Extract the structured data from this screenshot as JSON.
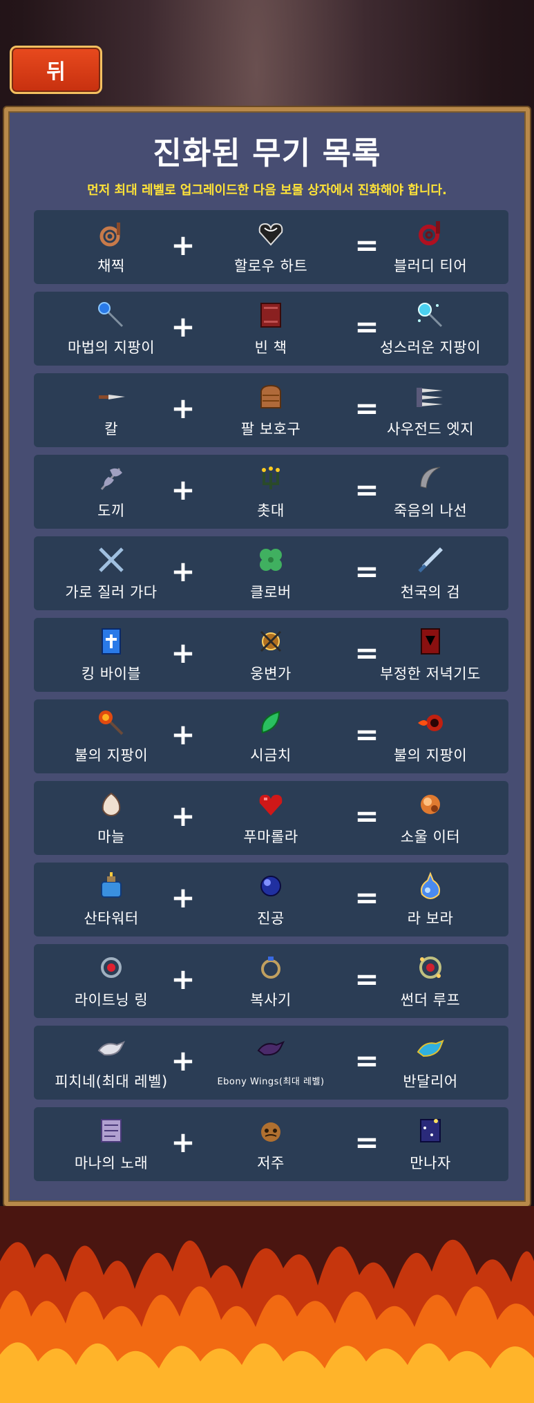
{
  "back_button": {
    "label": "뒤"
  },
  "panel": {
    "title": "진화된 무기 목록",
    "subtitle": "먼저 최대 레벨로 업그레이드한 다음 보물 상자에서 진화해야 합니다."
  },
  "plus_symbol": "+",
  "equals_symbol": "=",
  "recipes": [
    {
      "a": {
        "label": "채찍",
        "icon": "whip-icon"
      },
      "b": {
        "label": "할로우 하트",
        "icon": "hollow-heart-icon"
      },
      "r": {
        "label": "블러디 티어",
        "icon": "bloody-tear-icon"
      }
    },
    {
      "a": {
        "label": "마법의 지팡이",
        "icon": "magic-wand-icon"
      },
      "b": {
        "label": "빈 책",
        "icon": "empty-tome-icon"
      },
      "r": {
        "label": "성스러운 지팡이",
        "icon": "holy-wand-icon"
      }
    },
    {
      "a": {
        "label": "칼",
        "icon": "knife-icon"
      },
      "b": {
        "label": "팔 보호구",
        "icon": "bracer-icon"
      },
      "r": {
        "label": "사우전드 엣지",
        "icon": "thousand-edge-icon"
      }
    },
    {
      "a": {
        "label": "도끼",
        "icon": "axe-icon"
      },
      "b": {
        "label": "촛대",
        "icon": "candelabrador-icon"
      },
      "r": {
        "label": "죽음의 나선",
        "icon": "death-spiral-icon"
      }
    },
    {
      "a": {
        "label": "가로 질러 가다",
        "icon": "cross-icon"
      },
      "b": {
        "label": "클로버",
        "icon": "clover-icon"
      },
      "r": {
        "label": "천국의 검",
        "icon": "heaven-sword-icon"
      }
    },
    {
      "a": {
        "label": "킹 바이블",
        "icon": "king-bible-icon"
      },
      "b": {
        "label": "웅변가",
        "icon": "spellbinder-icon"
      },
      "r": {
        "label": "부정한 저녁기도",
        "icon": "unholy-vespers-icon"
      }
    },
    {
      "a": {
        "label": "불의 지팡이",
        "icon": "fire-wand-icon"
      },
      "b": {
        "label": "시금치",
        "icon": "spinach-icon"
      },
      "r": {
        "label": "불의 지팡이",
        "icon": "hellfire-icon"
      }
    },
    {
      "a": {
        "label": "마늘",
        "icon": "garlic-icon"
      },
      "b": {
        "label": "푸마롤라",
        "icon": "pummarola-icon"
      },
      "r": {
        "label": "소울 이터",
        "icon": "soul-eater-icon"
      }
    },
    {
      "a": {
        "label": "산타워터",
        "icon": "santa-water-icon"
      },
      "b": {
        "label": "진공",
        "icon": "attractorb-icon"
      },
      "r": {
        "label": "라 보라",
        "icon": "la-borra-icon"
      }
    },
    {
      "a": {
        "label": "라이트닝 링",
        "icon": "lightning-ring-icon"
      },
      "b": {
        "label": "복사기",
        "icon": "duplicator-icon"
      },
      "r": {
        "label": "썬더 루프",
        "icon": "thunder-loop-icon"
      }
    },
    {
      "a": {
        "label": "피치네(최대 레벨)",
        "icon": "peachone-icon"
      },
      "b": {
        "label": "Ebony Wings(최대 레벨)",
        "icon": "ebony-wings-icon",
        "small": true
      },
      "r": {
        "label": "반달리어",
        "icon": "vandalier-icon"
      }
    },
    {
      "a": {
        "label": "마나의 노래",
        "icon": "song-of-mana-icon"
      },
      "b": {
        "label": "저주",
        "icon": "curse-icon"
      },
      "r": {
        "label": "만나자",
        "icon": "mannajja-icon"
      }
    }
  ]
}
